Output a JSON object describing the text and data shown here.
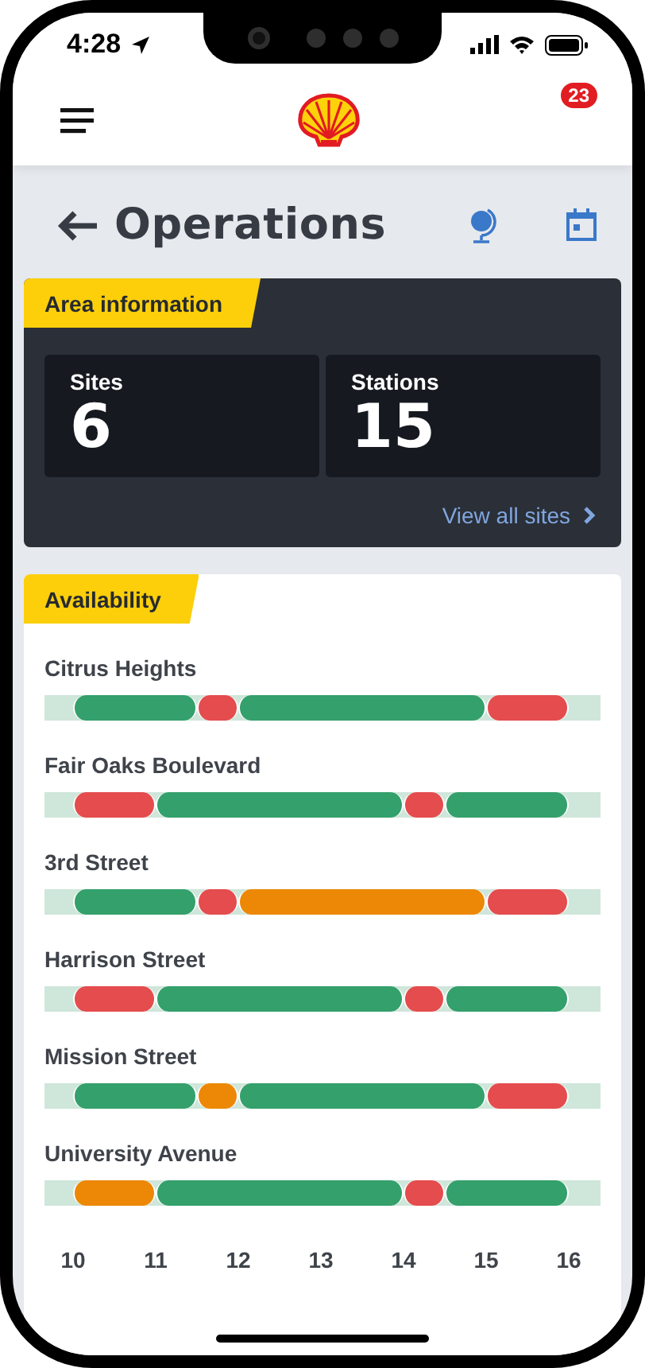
{
  "status_bar": {
    "time": "4:28"
  },
  "header": {
    "notification_count": "23"
  },
  "page": {
    "title": "Operations"
  },
  "area_information": {
    "tag": "Area information",
    "tiles": [
      {
        "label": "Sites",
        "value": "6"
      },
      {
        "label": "Stations",
        "value": "15"
      }
    ],
    "link": "View all sites"
  },
  "availability": {
    "tag": "Availability",
    "sites": [
      {
        "name": "Citrus Heights",
        "half_hours": [
          {
            "color": "#34a06c"
          },
          {
            "color": "#34a06c"
          },
          {
            "color": "#34a06c"
          },
          {
            "color": "#e44c4e"
          },
          {
            "color": "#34a06c"
          },
          {
            "color": "#34a06c"
          },
          {
            "color": "#34a06c"
          },
          {
            "color": "#34a06c"
          },
          {
            "color": "#34a06c"
          },
          {
            "color": "#34a06c"
          },
          {
            "color": "#e44c4e"
          },
          {
            "color": "#e44c4e"
          }
        ]
      },
      {
        "name": "Fair Oaks Boulevard",
        "half_hours": [
          {
            "color": "#e44c4e"
          },
          {
            "color": "#e44c4e"
          },
          {
            "color": "#34a06c"
          },
          {
            "color": "#34a06c"
          },
          {
            "color": "#34a06c"
          },
          {
            "color": "#34a06c"
          },
          {
            "color": "#34a06c"
          },
          {
            "color": "#34a06c"
          },
          {
            "color": "#e44c4e"
          },
          {
            "color": "#34a06c"
          },
          {
            "color": "#34a06c"
          },
          {
            "color": "#34a06c"
          }
        ]
      },
      {
        "name": "3rd Street",
        "half_hours": [
          {
            "color": "#34a06c"
          },
          {
            "color": "#34a06c"
          },
          {
            "color": "#34a06c"
          },
          {
            "color": "#e44c4e"
          },
          {
            "color": "#ec8806"
          },
          {
            "color": "#ec8806"
          },
          {
            "color": "#ec8806"
          },
          {
            "color": "#ec8806"
          },
          {
            "color": "#ec8806"
          },
          {
            "color": "#ec8806"
          },
          {
            "color": "#e44c4e"
          },
          {
            "color": "#e44c4e"
          }
        ]
      },
      {
        "name": "Harrison Street",
        "half_hours": [
          {
            "color": "#e44c4e"
          },
          {
            "color": "#e44c4e"
          },
          {
            "color": "#34a06c"
          },
          {
            "color": "#34a06c"
          },
          {
            "color": "#34a06c"
          },
          {
            "color": "#34a06c"
          },
          {
            "color": "#34a06c"
          },
          {
            "color": "#34a06c"
          },
          {
            "color": "#e44c4e"
          },
          {
            "color": "#34a06c"
          },
          {
            "color": "#34a06c"
          },
          {
            "color": "#34a06c"
          }
        ]
      },
      {
        "name": "Mission Street",
        "half_hours": [
          {
            "color": "#34a06c"
          },
          {
            "color": "#34a06c"
          },
          {
            "color": "#34a06c"
          },
          {
            "color": "#ec8806"
          },
          {
            "color": "#34a06c"
          },
          {
            "color": "#34a06c"
          },
          {
            "color": "#34a06c"
          },
          {
            "color": "#34a06c"
          },
          {
            "color": "#34a06c"
          },
          {
            "color": "#34a06c"
          },
          {
            "color": "#e44c4e"
          },
          {
            "color": "#e44c4e"
          }
        ]
      },
      {
        "name": "University Avenue",
        "half_hours": [
          {
            "color": "#ec8806"
          },
          {
            "color": "#ec8806"
          },
          {
            "color": "#34a06c"
          },
          {
            "color": "#34a06c"
          },
          {
            "color": "#34a06c"
          },
          {
            "color": "#34a06c"
          },
          {
            "color": "#34a06c"
          },
          {
            "color": "#34a06c"
          },
          {
            "color": "#e44c4e"
          },
          {
            "color": "#34a06c"
          },
          {
            "color": "#34a06c"
          },
          {
            "color": "#34a06c"
          }
        ]
      }
    ],
    "hours": [
      "10",
      "11",
      "12",
      "13",
      "14",
      "15",
      "16"
    ]
  }
}
